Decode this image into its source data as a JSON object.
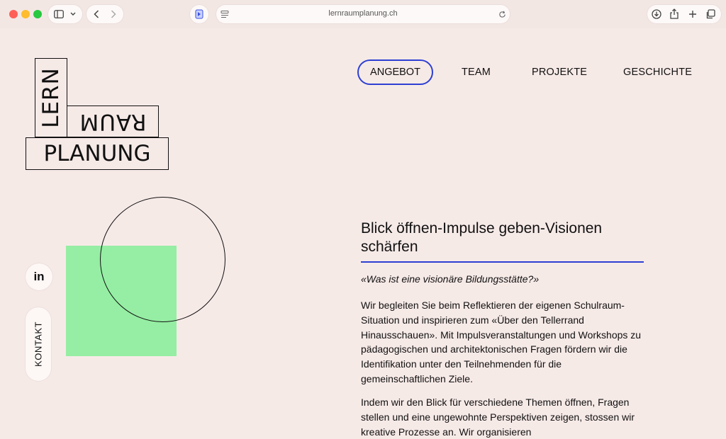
{
  "browser": {
    "url": "lernraumplanung.ch"
  },
  "logo": {
    "lern": "LERN",
    "raum": "RAUM",
    "planung": "PLANUNG"
  },
  "nav": {
    "items": [
      "ANGEBOT",
      "TEAM",
      "PROJEKTE",
      "GESCHICHTE"
    ],
    "active": "ANGEBOT"
  },
  "side": {
    "linkedin": "in",
    "kontakt": "KONTAKT"
  },
  "content": {
    "heading": "Blick öffnen-Impulse geben-Visionen schärfen",
    "quote": "«Was ist eine visionäre Bildungsstätte?»",
    "paragraph1": "Wir begleiten Sie beim Reflektieren der eigenen Schulraum-Situation und inspirieren zum «Über den Tellerrand Hinausschauen». Mit Impulsveranstaltungen und Workshops zu pädagogischen und architektonischen Fragen fördern wir die Identifikation unter den Teilnehmenden für die gemeinschaftlichen Ziele.",
    "paragraph2": "Indem wir den Blick für verschiedene Themen öffnen, Fragen stellen und eine ungewohnte Perspektiven zeigen, stossen wir kreative Prozesse an. Wir organisieren"
  },
  "colors": {
    "background": "#f6eae7",
    "accent": "#2d3fd3",
    "green": "#95eea3"
  }
}
